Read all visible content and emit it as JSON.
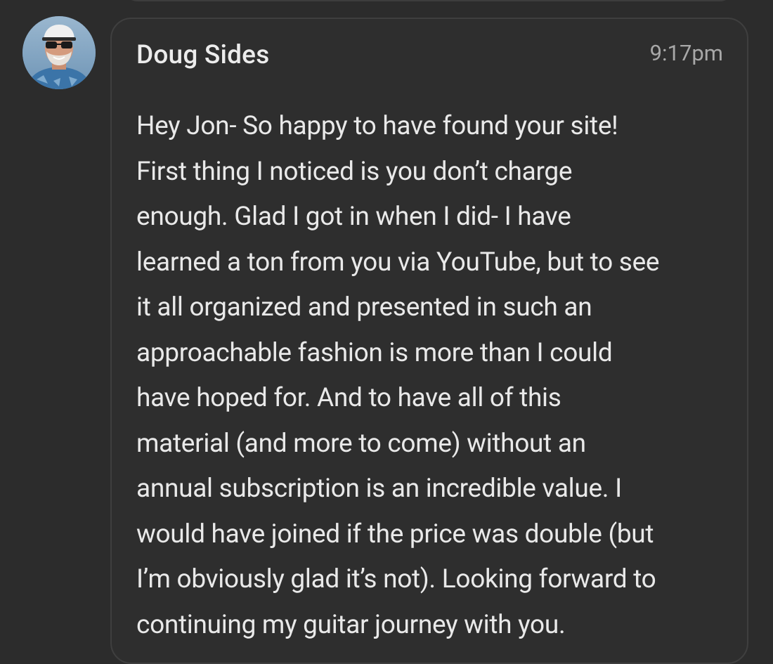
{
  "comment": {
    "author": "Doug Sides",
    "timestamp": "9:17pm",
    "avatar_icon": "user-avatar-photo",
    "body_lines": [
      "Hey Jon- So happy to have found your site!",
      "First thing I noticed is you don’t charge",
      "enough. Glad I got in when I did- I have",
      "learned a ton from you via YouTube, but to see",
      "it all organized and presented in such an",
      "approachable fashion is more than I could",
      "have hoped for. And to have all of this",
      "material (and more to come) without an",
      "annual subscription is an incredible value. I",
      "would have joined if the price was double (but",
      "I’m obviously glad it’s not). Looking forward to",
      "continuing my guitar journey with you."
    ]
  },
  "colors": {
    "background": "#2c2c2c",
    "card_border": "#3f3f3f",
    "text": "#e9e9e9",
    "timestamp": "#a8a8a8"
  }
}
